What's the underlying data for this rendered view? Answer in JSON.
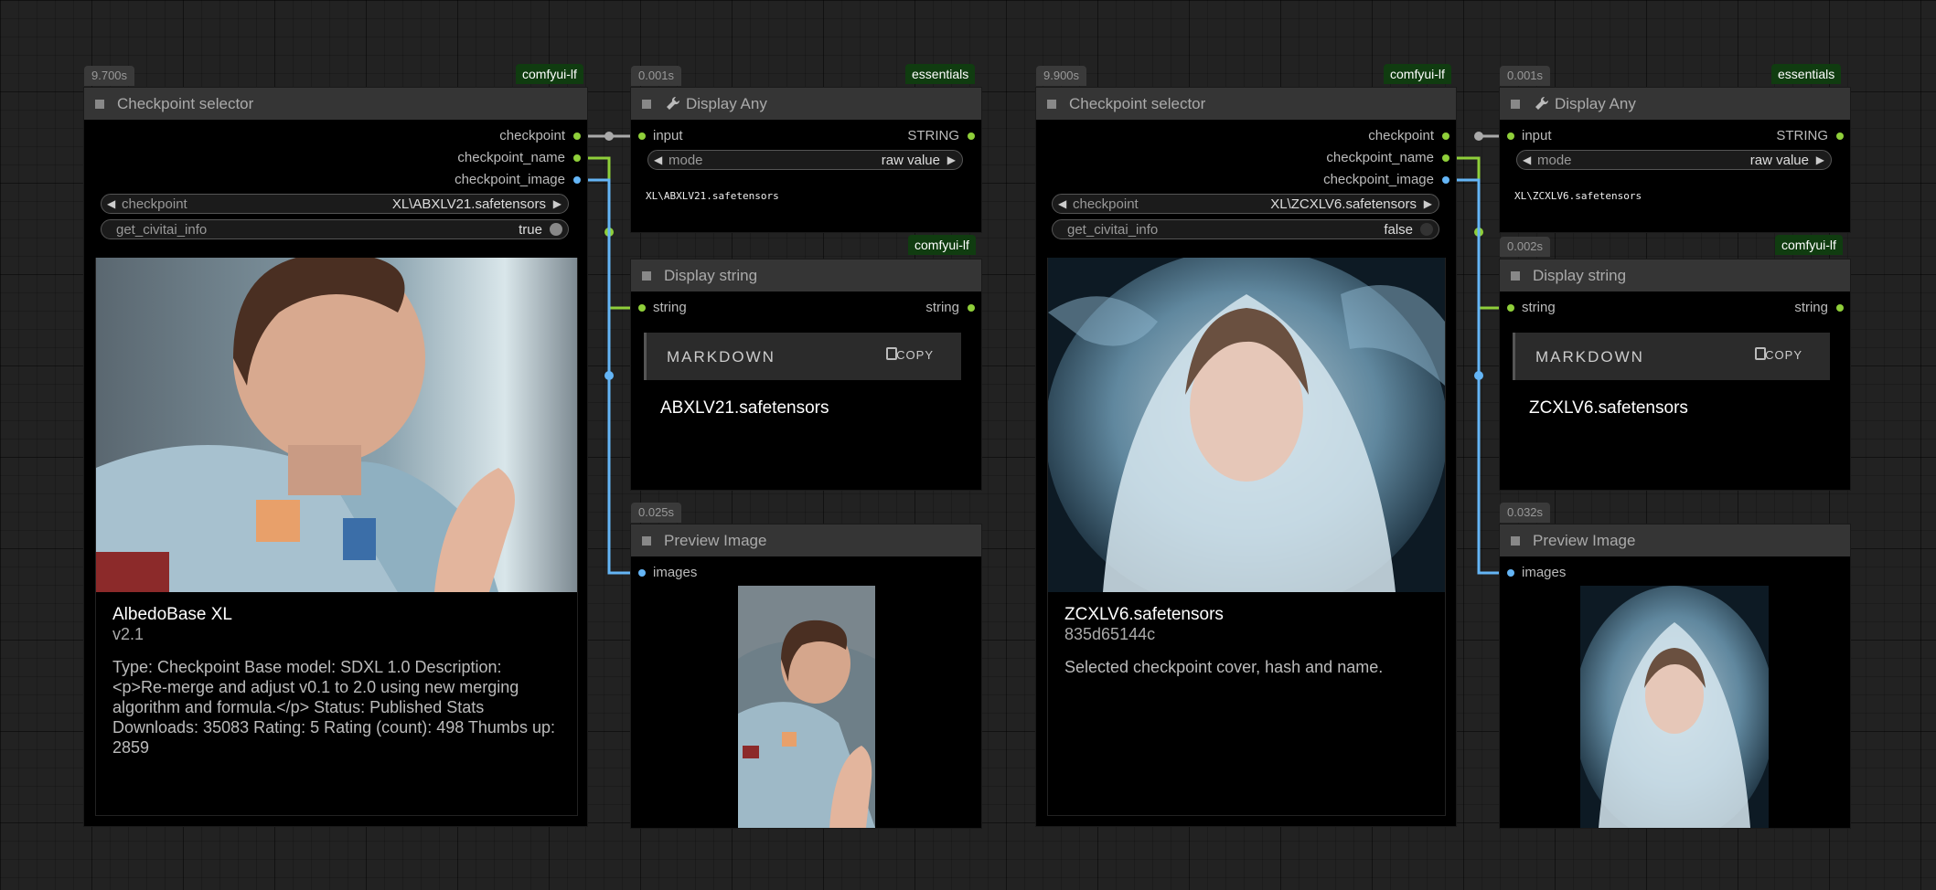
{
  "colors": {
    "canvas": "#222222",
    "link_string": "#8fcf3a",
    "link_image": "#64b5f6",
    "link_model": "#aaaaaa"
  },
  "left": {
    "selector": {
      "timing": "9.700s",
      "badge": "comfyui-lf",
      "title": "Checkpoint selector",
      "outputs": [
        "checkpoint",
        "checkpoint_name",
        "checkpoint_image"
      ],
      "checkpoint_label": "checkpoint",
      "checkpoint_value": "XL\\ABXLV21.safetensors",
      "civitai_label": "get_civitai_info",
      "civitai_value": "true",
      "image_icon": "portrait-astronaut-image",
      "card_title": "AlbedoBase XL",
      "card_sub": "v2.1",
      "card_desc": "Type: Checkpoint Base model: SDXL 1.0 Description: <p>Re-merge and adjust v0.1 to 2.0 using new merging algorithm and formula.</p> Status: Published Stats Downloads: 35083 Rating: 5 Rating (count): 498 Thumbs up: 2859"
    },
    "display_any": {
      "timing": "0.001s",
      "badge": "essentials",
      "title": "Display Any",
      "input": "input",
      "output": "STRING",
      "mode_label": "mode",
      "mode_value": "raw value",
      "text": "XL\\ABXLV21.safetensors"
    },
    "display_string": {
      "badge": "comfyui-lf",
      "title": "Display string",
      "input": "string",
      "output": "string",
      "md_label": "MARKDOWN",
      "copy_label": "COPY",
      "text": "ABXLV21.safetensors"
    },
    "preview": {
      "timing": "0.025s",
      "title": "Preview Image",
      "input": "images",
      "image_icon": "portrait-astronaut-image"
    }
  },
  "right": {
    "selector": {
      "timing": "9.900s",
      "badge": "comfyui-lf",
      "title": "Checkpoint selector",
      "outputs": [
        "checkpoint",
        "checkpoint_name",
        "checkpoint_image"
      ],
      "checkpoint_label": "checkpoint",
      "checkpoint_value": "XL\\ZCXLV6.safetensors",
      "civitai_label": "get_civitai_info",
      "civitai_value": "false",
      "image_icon": "portrait-veiled-woman-image",
      "card_title": "ZCXLV6.safetensors",
      "card_sub": "835d65144c",
      "card_desc": "Selected checkpoint cover, hash and name."
    },
    "display_any": {
      "timing": "0.001s",
      "badge": "essentials",
      "title": "Display Any",
      "input": "input",
      "output": "STRING",
      "mode_label": "mode",
      "mode_value": "raw value",
      "text": "XL\\ZCXLV6.safetensors"
    },
    "display_string": {
      "timing": "0.002s",
      "badge": "comfyui-lf",
      "title": "Display string",
      "input": "string",
      "output": "string",
      "md_label": "MARKDOWN",
      "copy_label": "COPY",
      "text": "ZCXLV6.safetensors"
    },
    "preview": {
      "timing": "0.032s",
      "title": "Preview Image",
      "input": "images",
      "image_icon": "portrait-veiled-woman-image"
    }
  }
}
